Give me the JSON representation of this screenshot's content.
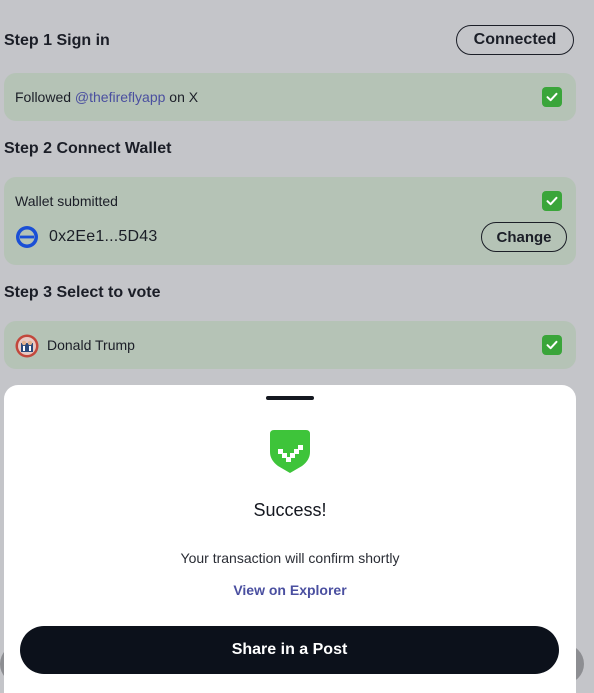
{
  "step1": {
    "title": "Step 1 Sign in",
    "status_button": "Connected",
    "followed_prefix": "Followed",
    "followed_handle": "@thefireflyapp",
    "followed_suffix": "on X"
  },
  "step2": {
    "title": "Step 2 Connect Wallet",
    "wallet_label": "Wallet submitted",
    "wallet_address": "0x2Ee1...5D43",
    "change_button": "Change"
  },
  "step3": {
    "title": "Step 3 Select to vote",
    "candidate": "Donald Trump"
  },
  "modal": {
    "title": "Success!",
    "message": "Your transaction will confirm shortly",
    "explorer_link": "View on Explorer",
    "share_button": "Share in a Post"
  },
  "colors": {
    "background": "#c4c5c9",
    "card": "#b5c3b6",
    "check": "#3aa53a",
    "link": "#4a4fa0",
    "primary_button": "#0c111b",
    "shield": "#3ec43a"
  },
  "icons": {
    "check": "check-icon",
    "wallet": "wallet-network-icon",
    "candidate": "candidate-avatar",
    "success": "shield-check-icon"
  }
}
